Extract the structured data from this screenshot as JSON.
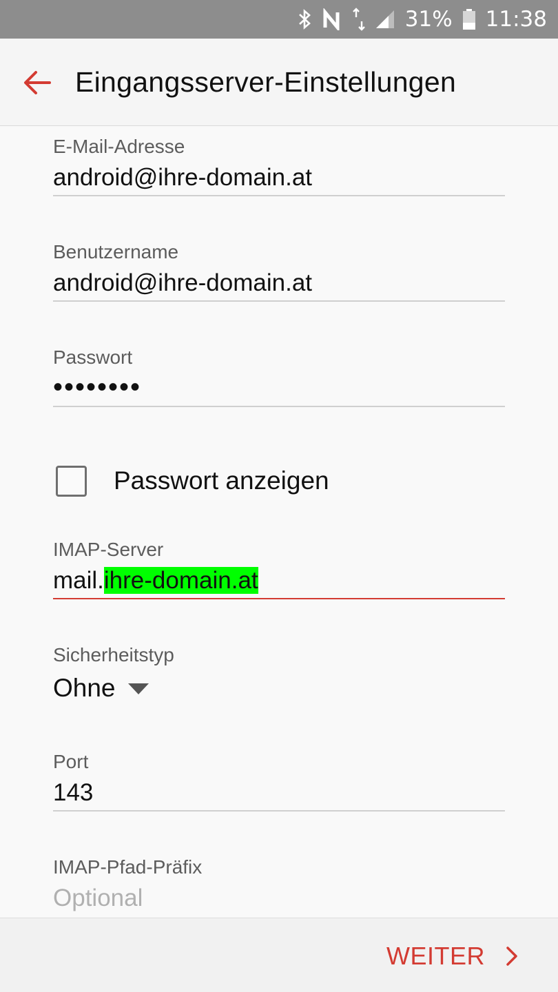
{
  "status_bar": {
    "icons": [
      "bluetooth-icon",
      "nfc-icon",
      "data-arrows-icon",
      "signal-icon",
      "battery-icon"
    ],
    "battery": "31%",
    "time": "11:38"
  },
  "header": {
    "back_icon": "arrow-left-icon",
    "title": "Eingangsserver-Einstellungen"
  },
  "form": {
    "email": {
      "label": "E-Mail-Adresse",
      "value": "android@ihre-domain.at"
    },
    "username": {
      "label": "Benutzername",
      "value": "android@ihre-domain.at"
    },
    "password": {
      "label": "Passwort",
      "value": "••••••••"
    },
    "show_password": {
      "label": "Passwort anzeigen",
      "checked": false
    },
    "imap_server": {
      "label": "IMAP-Server",
      "value_prefix": "mail.",
      "value_highlight": "ihre-domain.at"
    },
    "security_type": {
      "label": "Sicherheitstyp",
      "value": "Ohne"
    },
    "port": {
      "label": "Port",
      "value": "143"
    },
    "imap_prefix": {
      "label": "IMAP-Pfad-Präfix",
      "placeholder": "Optional"
    }
  },
  "footer": {
    "next_label": "WEITER"
  },
  "colors": {
    "accent": "#d33b32",
    "highlight": "#00ff00",
    "status_bar": "#8d8d8d"
  }
}
